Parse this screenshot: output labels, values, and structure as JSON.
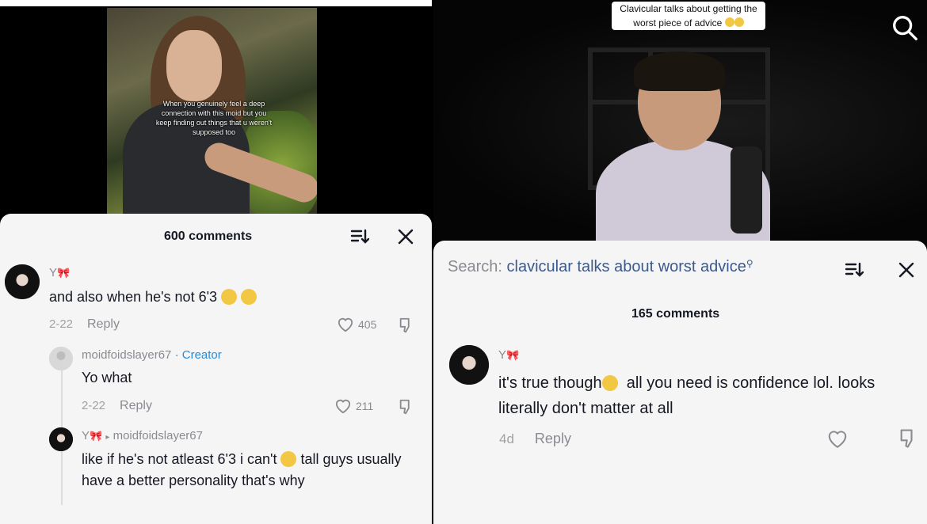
{
  "left": {
    "video_overlay_text": "When you genuinely feel a deep connection with this moid but you keep finding out things that u weren't supposed too",
    "comments_count": "600 comments",
    "comments": [
      {
        "username": "Y",
        "text": "and also when he's not 6'3",
        "date": "2-22",
        "reply_label": "Reply",
        "likes": "405"
      },
      {
        "username": "moidfoidslayer67",
        "badge": "· Creator",
        "text": "Yo what",
        "date": "2-22",
        "reply_label": "Reply",
        "likes": "211"
      },
      {
        "username": "Y",
        "reply_to": "moidfoidslayer67",
        "text_part1": "like if he's not atleast 6'3 i can't",
        "text_part2": "tall guys usually have a better personality that's why"
      }
    ]
  },
  "right": {
    "caption": "Clavicular talks about getting the worst piece of advice",
    "search_label": "Search:",
    "search_query": "clavicular talks about worst advice",
    "comments_count": "165 comments",
    "comment": {
      "username": "Y",
      "text_part1": "it's true though",
      "text_part2": "all you need is confidence lol. looks literally don't matter at all",
      "date": "4d",
      "reply_label": "Reply"
    }
  },
  "icons": [
    "search-icon",
    "sort-icon",
    "close-icon",
    "heart-icon",
    "dislike-icon",
    "bow-icon",
    "emoji-icon"
  ]
}
